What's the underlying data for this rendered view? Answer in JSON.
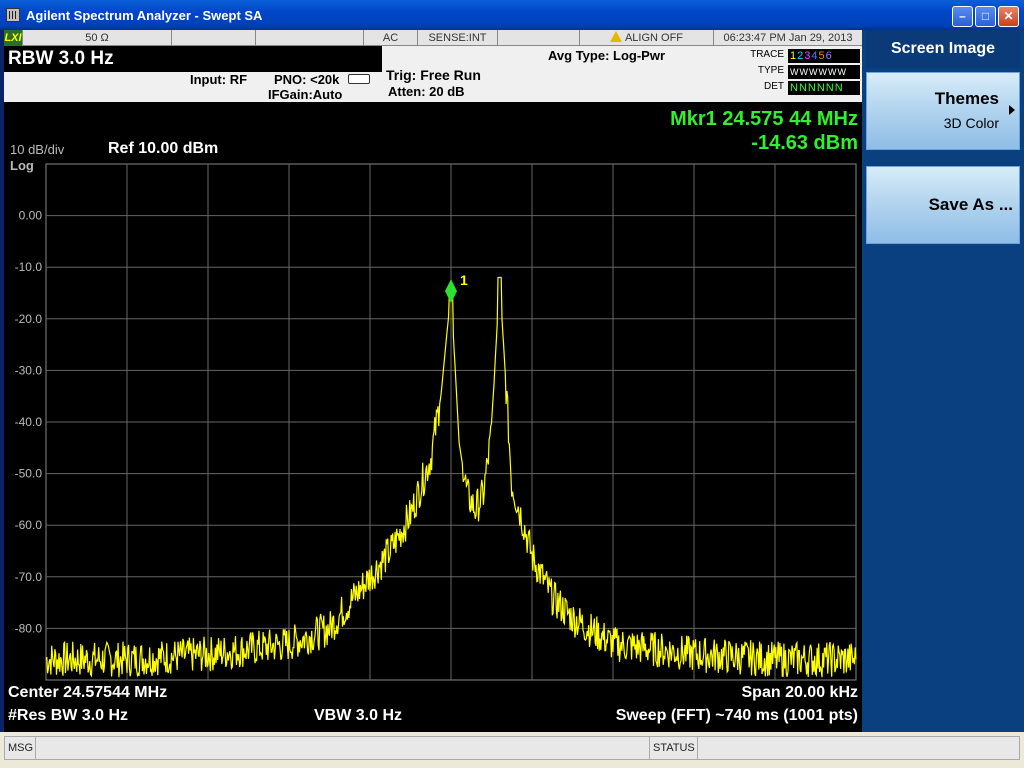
{
  "window": {
    "title": "Agilent Spectrum Analyzer - Swept SA"
  },
  "status_strip": {
    "lxi": "LXI",
    "impedance": "50 Ω",
    "coupling": "AC",
    "sense": "SENSE:INT",
    "align": "ALIGN OFF",
    "datetime": "06:23:47 PM Jan 29, 2013"
  },
  "settings": {
    "rbw": "RBW  3.0 Hz",
    "input": "Input: RF",
    "pno": "PNO: <20k",
    "ifgain": "IFGain:Auto",
    "trig": "Trig: Free Run",
    "atten": "Atten: 20 dB",
    "avg_type": "Avg Type: Log-Pwr"
  },
  "trace_panel": {
    "trace_label": "TRACE",
    "trace_nums": [
      "1",
      "2",
      "3",
      "4",
      "5",
      "6"
    ],
    "trace_colors": [
      "#ffff00",
      "#00e0ff",
      "#ff40ff",
      "#4080ff",
      "#ff8000",
      "#8080ff"
    ],
    "type_label": "TYPE",
    "type_val": "WWWWWW",
    "det_label": "DET",
    "det_val": "NNNNNN"
  },
  "display": {
    "scale": "10 dB/div",
    "log": "Log",
    "ref": "Ref 10.00 dBm",
    "marker_freq": "Mkr1 24.575 44 MHz",
    "marker_amp": "-14.63 dBm",
    "marker_label": "1",
    "center": "Center 24.57544 MHz",
    "span": "Span 20.00 kHz",
    "res_bw": "#Res BW 3.0 Hz",
    "vbw": "VBW 3.0 Hz",
    "sweep": "Sweep (FFT)  ~740 ms (1001 pts)"
  },
  "chart_data": {
    "type": "line",
    "xlabel": "",
    "ylabel": "",
    "ylim": [
      -90,
      10
    ],
    "y_ticks": [
      "0.00",
      "-10.0",
      "-20.0",
      "-30.0",
      "-40.0",
      "-50.0",
      "-60.0",
      "-70.0",
      "-80.0"
    ],
    "x_range_khz": [
      -10,
      10
    ],
    "grid": true,
    "trace_color": "#ffff00",
    "series": [
      {
        "x": [
          -10,
          -8,
          -6,
          -4,
          -3,
          -2.5,
          -2,
          -1.5,
          -1.0,
          -0.5,
          -0.25,
          0,
          0.2,
          0.4,
          0.6,
          0.8,
          1.0,
          1.2,
          1.5,
          1.8,
          2.0,
          2.5,
          3,
          4,
          6,
          8,
          10
        ],
        "y": [
          -86,
          -86,
          -85,
          -83,
          -80,
          -75,
          -70,
          -65,
          -58,
          -47,
          -35,
          -14.6,
          -44,
          -54,
          -57,
          -54,
          -42,
          -12,
          -52,
          -60,
          -66,
          -74,
          -78,
          -83,
          -85,
          -86,
          -86
        ]
      }
    ],
    "marker": {
      "x": 0,
      "y": -14.63,
      "label": "1"
    }
  },
  "softkeys": {
    "title": "Screen Image",
    "keys": [
      {
        "label": "Themes",
        "sublabel": "3D Color"
      },
      {
        "label": "Save As ..."
      }
    ]
  },
  "bottom": {
    "msg": "MSG",
    "status": "STATUS"
  }
}
